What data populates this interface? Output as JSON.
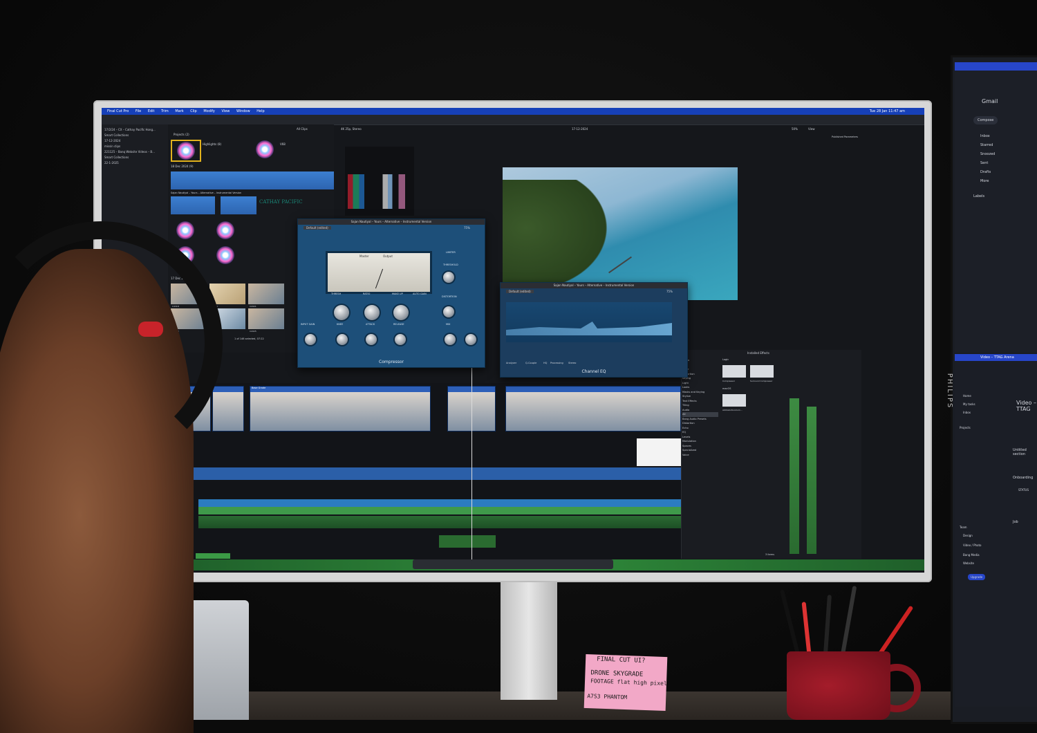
{
  "app": {
    "name": "Final Cut Pro",
    "menu": [
      "Final Cut Pro",
      "File",
      "Edit",
      "Trim",
      "Mark",
      "Clip",
      "Modify",
      "View",
      "Window",
      "Help"
    ],
    "clock": "Tue 28 Jan 11:47 am"
  },
  "sidebar": {
    "items": [
      "17/2/24 – CX – Cathay Pacific Hong...",
      "Smart Collections",
      "17-12-2024",
      "missin clips",
      "221125 – Banq Website Videos – B...",
      "Smart Collections",
      "22-1-2025"
    ]
  },
  "browser": {
    "projects_label": "Projects",
    "projects_count": "(2)",
    "project1": "Highlights (8)",
    "project2": "V68",
    "section1": "18 Dec 2024",
    "section1_count": "(9)",
    "section2": "17 Dec 2024",
    "section2_count": "(120)",
    "audio_label": "Sajan Nautiyal – Yours – Alternative – Instrumental Version",
    "brand_text": "CATHAY PACIFIC",
    "selection_status": "1 of 146 selected, 07:22",
    "clip_labels": [
      "C4318",
      "C4320",
      "C4321",
      "C4322",
      "C4323",
      "C4324",
      "C4325"
    ]
  },
  "viewer": {
    "filter": "All Clips",
    "format": "4K 25p, Stereo",
    "date": "17-12-2024",
    "zoom": "50%",
    "view": "View",
    "inspector": "Published Parameters"
  },
  "compressor": {
    "title": "Sajan Nautiyal – Yours – Alternative – Instrumental Version",
    "preset": "Default (edited)",
    "percent": "75%",
    "meter_labels": [
      "Master",
      "Output"
    ],
    "knob_labels": [
      "THRESH",
      "RATIO",
      "MAKE UP",
      "AUTO GAIN",
      "DISTORTION",
      "INPUT GAIN",
      "KNEE",
      "ATTACK",
      "RELEASE",
      "MIX",
      "LIMITER",
      "THRESHOLD"
    ],
    "name": "Compressor"
  },
  "eq": {
    "title": "Sajan Nautiyal – Yours – Alternative – Instrumental Version",
    "preset": "Default (edited)",
    "percent": "75%",
    "name": "Channel EQ",
    "buttons": [
      "Analyzer",
      "Q-Couple",
      "HQ",
      "Processing",
      "Stereo"
    ]
  },
  "timeline": {
    "clip_title": "Base Grade"
  },
  "effects": {
    "header": "Installed Effects",
    "categories": [
      "Video",
      "All",
      "Color",
      "Distortion",
      "Keying",
      "Light",
      "Looks",
      "Masks and Keying",
      "Stylize",
      "Text Effects",
      "Tiling",
      "Audio",
      "All",
      "Bang Audio Presets",
      "Distortion",
      "Echo",
      "EQ",
      "Levels",
      "Modulation",
      "Spaces",
      "Specialized",
      "Voice"
    ],
    "groups": [
      "Logic",
      "macOS"
    ],
    "items": [
      "Compressor",
      "Surround Compressor",
      "AUDistortionCom..."
    ],
    "count": "3 items"
  },
  "right_monitor": {
    "app": "Gmail",
    "compose": "Compose",
    "mail_items": [
      "Inbox",
      "Starred",
      "Snoozed",
      "Sent",
      "Drafts",
      "More"
    ],
    "labels_title": "Labels",
    "tab_title": "Video – TTAG Arena",
    "project_title": "Video – TTAG",
    "sections": [
      "Home",
      "My tasks",
      "Inbox",
      "Projects",
      "Team",
      "Design",
      "Video / Photo",
      "Bang Media",
      "Website"
    ],
    "right_labels": [
      "Untitled section",
      "Onboarding",
      "Job",
      "STATUS"
    ],
    "upgrade": "Upgrade"
  },
  "sticky_note": {
    "lines": [
      "FINAL CUT UI?",
      "DRONE  SKYGRADE",
      "FOOTAGE  flat  high pixel",
      "A7S3  PHANTOM"
    ]
  },
  "monitor_brand": "PHILIPS",
  "colors": {
    "menubar": "#1640b8",
    "plugin_blue": "#1d4f79",
    "clip_blue": "#2d5fb8",
    "waveform_green": "#3f9a4a",
    "mug_red": "#a41c2a",
    "sticky_pink": "#f2a8c7"
  }
}
